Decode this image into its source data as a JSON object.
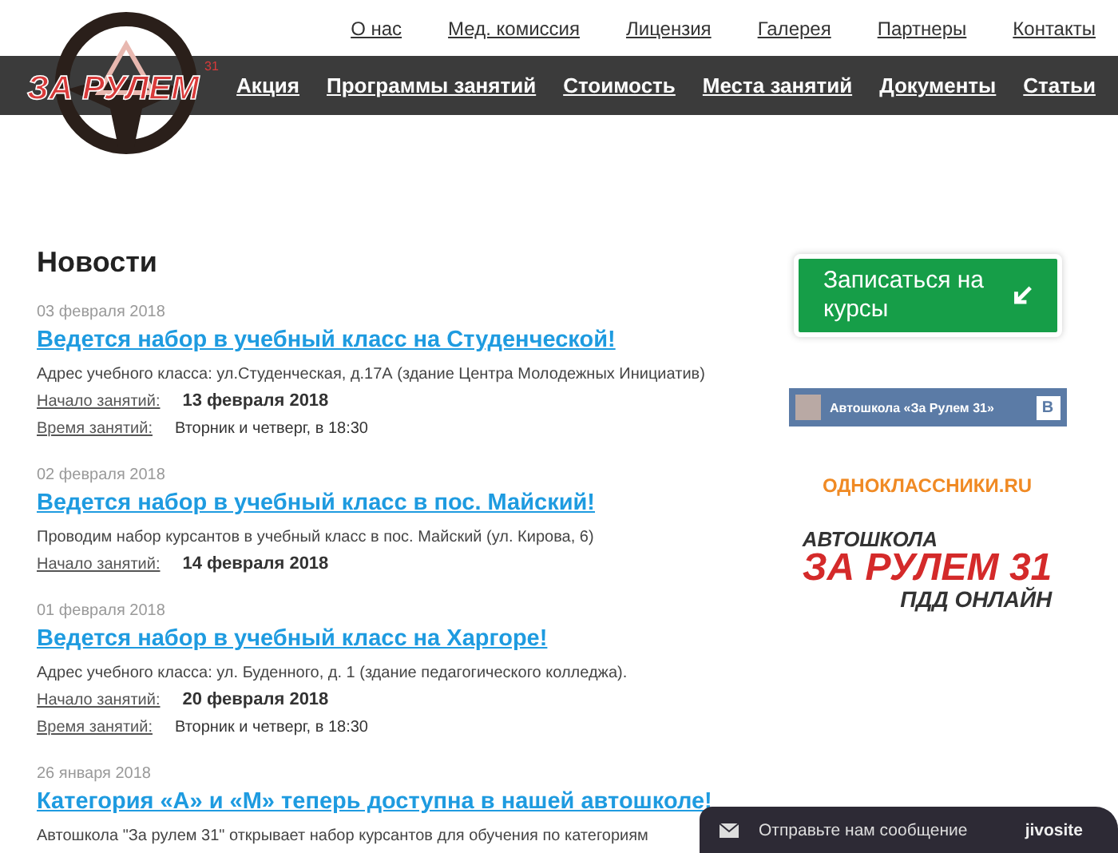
{
  "logo": {
    "text": "ЗА РУЛЕМ",
    "mark": "31"
  },
  "top_menu": [
    "О нас",
    "Мед. комиссия",
    "Лицензия",
    "Галерея",
    "Партнеры",
    "Контакты"
  ],
  "main_menu": [
    "Акция",
    "Программы занятий",
    "Стоимость",
    "Места занятий",
    "Документы",
    "Статьи"
  ],
  "news": {
    "title": "Новости",
    "items": [
      {
        "date": "03 февраля 2018",
        "title": "Ведется набор в учебный класс на Студенческой!",
        "lines": [
          {
            "kind": "text",
            "text": "Адрес учебного класса: ул.Студенческая, д.17А (здание Центра Молодежных Инициатив)"
          },
          {
            "kind": "field",
            "label": "Начало занятий:",
            "value": "13 февраля 2018",
            "emphasis": true
          },
          {
            "kind": "field",
            "label": "Время занятий:",
            "value": "Вторник и четверг, в 18:30",
            "emphasis": false
          }
        ]
      },
      {
        "date": "02 февраля 2018",
        "title": "Ведется набор в учебный класс в пос. Майский!",
        "lines": [
          {
            "kind": "text",
            "text": "Проводим набор курсантов в учебный класс в пос. Майский (ул. Кирова, 6)"
          },
          {
            "kind": "field",
            "label": "Начало занятий:",
            "value": "14 февраля 2018",
            "emphasis": true
          }
        ]
      },
      {
        "date": "01 февраля 2018",
        "title": "Ведется набор в учебный класс на Харгоре!",
        "lines": [
          {
            "kind": "text",
            "text": "Адрес учебного класса: ул. Буденного, д. 1 (здание педагогического колледжа)."
          },
          {
            "kind": "field",
            "label": "Начало занятий:",
            "value": "20 февраля 2018",
            "emphasis": true
          },
          {
            "kind": "field",
            "label": "Время занятий:",
            "value": "Вторник и четверг, в 18:30",
            "emphasis": false
          }
        ]
      },
      {
        "date": "26 января 2018",
        "title": "Категория «А» и «М» теперь доступна в нашей автошколе!",
        "lines": [
          {
            "kind": "text",
            "text": "Автошкола \"За рулем 31\" открывает набор курсантов для обучения по категориям"
          }
        ]
      }
    ]
  },
  "sidebar": {
    "signup_button": "Записаться на курсы",
    "vk_widget": {
      "name": "Автошкола «За Рулем 31»",
      "badge": "В"
    },
    "ok_link": "ОДНОКЛАССНИКИ.RU",
    "banner": {
      "top": "АВТОШКОЛА",
      "main": "ЗА РУЛЕМ 31",
      "bottom": "ПДД ОНЛАЙН"
    }
  },
  "chat_widget": {
    "label": "Отправьте нам сообщение",
    "brand": "jivosite"
  }
}
